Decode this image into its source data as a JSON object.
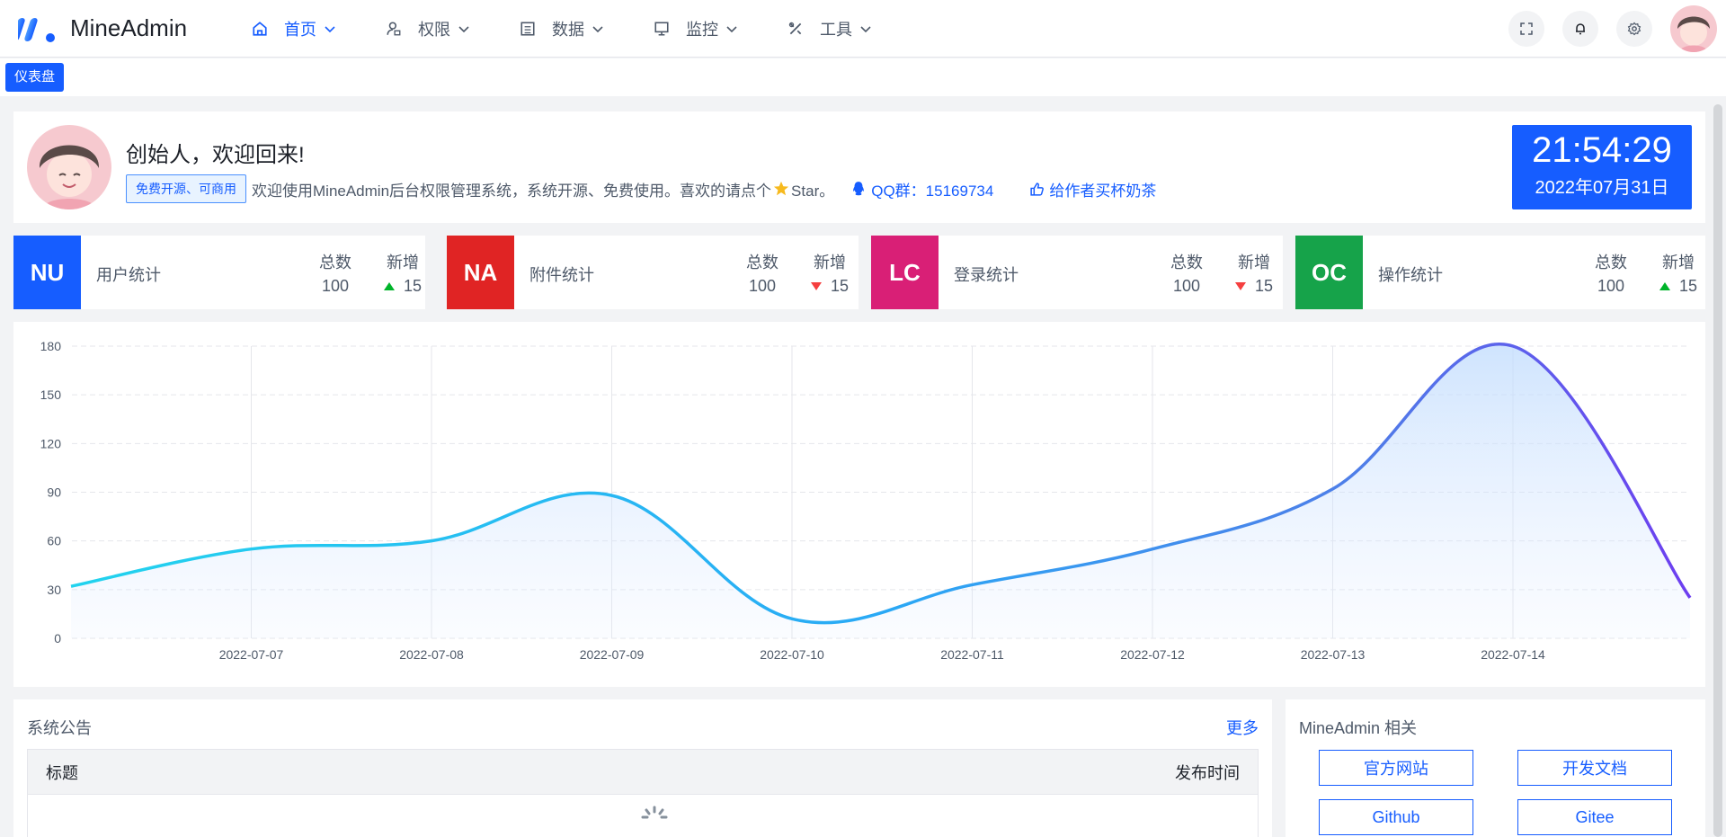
{
  "app": {
    "logo_text": "MineAdmin"
  },
  "nav": {
    "items": [
      {
        "label": "首页",
        "icon": "home-icon",
        "active": true
      },
      {
        "label": "权限",
        "icon": "user-lock-icon",
        "active": false
      },
      {
        "label": "数据",
        "icon": "database-icon",
        "active": false
      },
      {
        "label": "监控",
        "icon": "monitor-icon",
        "active": false
      },
      {
        "label": "工具",
        "icon": "tools-icon",
        "active": false
      }
    ],
    "tools": [
      "fullscreen-icon",
      "bell-icon",
      "gear-icon"
    ]
  },
  "tabs": [
    {
      "label": "仪表盘",
      "active": true
    }
  ],
  "welcome": {
    "title": "创始人，欢迎回来!",
    "tag": "免费开源、可商用",
    "text_before_star": "欢迎使用MineAdmin后台权限管理系统，系统开源、免费使用。喜欢的请点个",
    "star_label": "Star。",
    "qq": "QQ群：15169734",
    "tea": "给作者买杯奶茶"
  },
  "clock": {
    "time": "21:54:29",
    "date": "2022年07月31日"
  },
  "stats": [
    {
      "badge": "NU",
      "name": "用户统计",
      "total_label": "总数",
      "total": "100",
      "new_label": "新增",
      "new": "15",
      "trend": "up",
      "color": "#165dff"
    },
    {
      "badge": "NA",
      "name": "附件统计",
      "total_label": "总数",
      "total": "100",
      "new_label": "新增",
      "new": "15",
      "trend": "down",
      "color": "#e02424"
    },
    {
      "badge": "LC",
      "name": "登录统计",
      "total_label": "总数",
      "total": "100",
      "new_label": "新增",
      "new": "15",
      "trend": "down",
      "color": "#d91f76"
    },
    {
      "badge": "OC",
      "name": "操作统计",
      "total_label": "总数",
      "total": "100",
      "new_label": "新增",
      "new": "15",
      "trend": "up",
      "color": "#16a34a"
    }
  ],
  "chart_data": {
    "type": "area",
    "categories": [
      "",
      "2022-07-07",
      "2022-07-08",
      "2022-07-09",
      "2022-07-10",
      "2022-07-11",
      "2022-07-12",
      "2022-07-13",
      "2022-07-14",
      ""
    ],
    "values": [
      32,
      55,
      60,
      88,
      12,
      33,
      55,
      92,
      180,
      25
    ],
    "yticks": [
      0,
      30,
      60,
      90,
      120,
      150,
      180
    ],
    "ylim": [
      0,
      180
    ],
    "grid": true
  },
  "notice": {
    "title": "系统公告",
    "more": "更多",
    "col_title": "标题",
    "col_time": "发布时间"
  },
  "related": {
    "title": "MineAdmin 相关",
    "links": [
      "官方网站",
      "开发文档",
      "Github",
      "Gitee"
    ]
  }
}
